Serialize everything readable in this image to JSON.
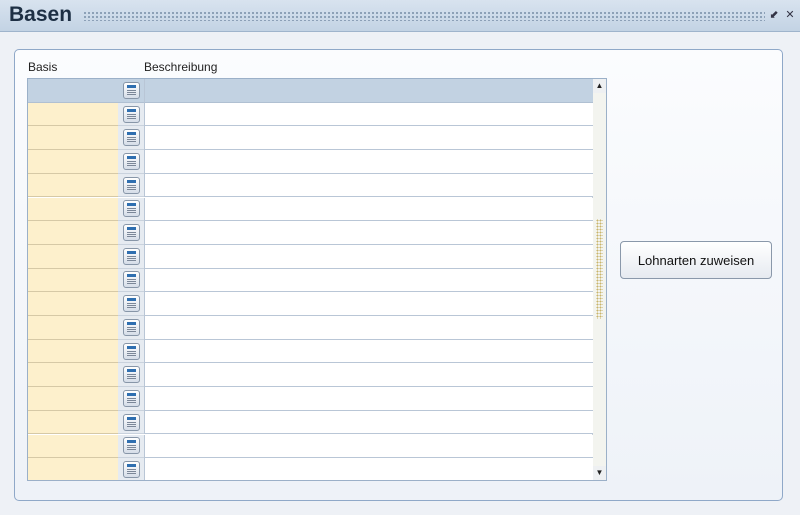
{
  "window": {
    "title": "Basen",
    "icons": [
      "minimize-icon",
      "close-icon"
    ]
  },
  "table": {
    "columns": [
      "Basis",
      "Beschreibung"
    ],
    "rows": [
      {
        "basis": "",
        "beschreibung": "",
        "selected": true
      },
      {
        "basis": "",
        "beschreibung": ""
      },
      {
        "basis": "",
        "beschreibung": ""
      },
      {
        "basis": "",
        "beschreibung": ""
      },
      {
        "basis": "",
        "beschreibung": ""
      },
      {
        "basis": "",
        "beschreibung": ""
      },
      {
        "basis": "",
        "beschreibung": ""
      },
      {
        "basis": "",
        "beschreibung": ""
      },
      {
        "basis": "",
        "beschreibung": ""
      },
      {
        "basis": "",
        "beschreibung": ""
      },
      {
        "basis": "",
        "beschreibung": ""
      },
      {
        "basis": "",
        "beschreibung": ""
      },
      {
        "basis": "",
        "beschreibung": ""
      },
      {
        "basis": "",
        "beschreibung": ""
      },
      {
        "basis": "",
        "beschreibung": ""
      },
      {
        "basis": "",
        "beschreibung": ""
      },
      {
        "basis": "",
        "beschreibung": ""
      }
    ]
  },
  "actions": {
    "assign_label": "Lohnarten zuweisen"
  },
  "colors": {
    "selected_row": "#c2d2e2",
    "basis_field": "#fdf0cc",
    "title_text": "#1d2f44"
  }
}
